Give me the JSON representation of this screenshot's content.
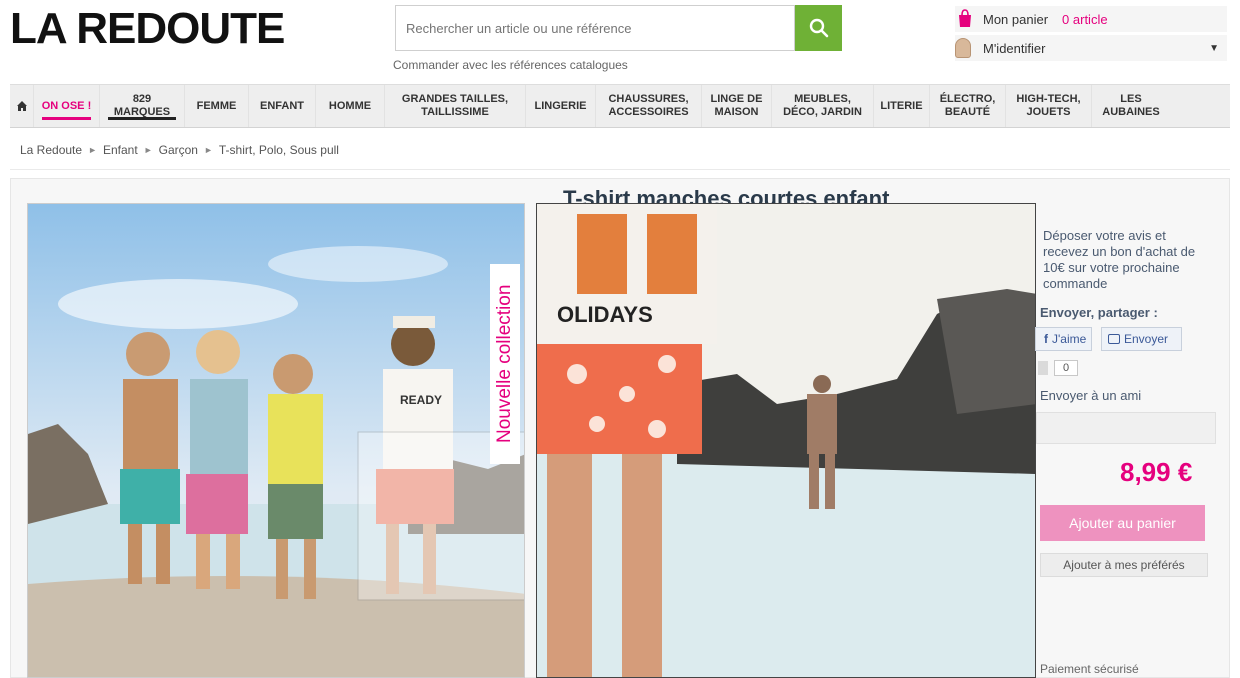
{
  "brand": {
    "logo": "LA REDOUTE"
  },
  "search": {
    "placeholder": "Rechercher un article ou une référence",
    "catalog_link": "Commander avec les références catalogues"
  },
  "cart": {
    "label": "Mon panier",
    "count": "0 article"
  },
  "account": {
    "label": "M'identifier"
  },
  "nav": {
    "items": [
      {
        "label": "ON OSE !",
        "highlight": true
      },
      {
        "label": "829\nMARQUES"
      },
      {
        "label": "FEMME"
      },
      {
        "label": "ENFANT"
      },
      {
        "label": "HOMME"
      },
      {
        "label": "GRANDES TAILLES,\nTAILLISSIME"
      },
      {
        "label": "LINGERIE"
      },
      {
        "label": "CHAUSSURES,\nACCESSOIRES"
      },
      {
        "label": "LINGE DE\nMAISON"
      },
      {
        "label": "MEUBLES,\nDÉCO, JARDIN"
      },
      {
        "label": "LITERIE"
      },
      {
        "label": "ÉLECTRO,\nBEAUTÉ"
      },
      {
        "label": "HIGH-TECH,\nJOUETS"
      },
      {
        "label": "LES\nAUBAINES"
      }
    ]
  },
  "breadcrumb": [
    "La Redoute",
    "Enfant",
    "Garçon",
    "T-shirt, Polo, Sous pull"
  ],
  "product": {
    "title": "T-shirt manches courtes enfant",
    "image_badge": "Nouvelle collection",
    "tshirt_print": "READY",
    "tshirt_print_zoom": "OLIDAYS",
    "price": "8,99 €"
  },
  "side": {
    "review_text": "Déposer votre avis et recevez un bon d'achat de 10€ sur votre prochaine commande",
    "share_label": "Envoyer, partager :",
    "like_label": "J'aime",
    "send_label": "Envoyer",
    "gplus_count": "0",
    "send_friend": "Envoyer à un ami",
    "add_cart": "Ajouter au panier",
    "add_fav": "Ajouter à mes préférés",
    "payment_note": "Paiement sécurisé"
  },
  "colors": {
    "accent": "#e5007e",
    "search_button": "#6fb136",
    "cart_button": "#ee92bf"
  }
}
